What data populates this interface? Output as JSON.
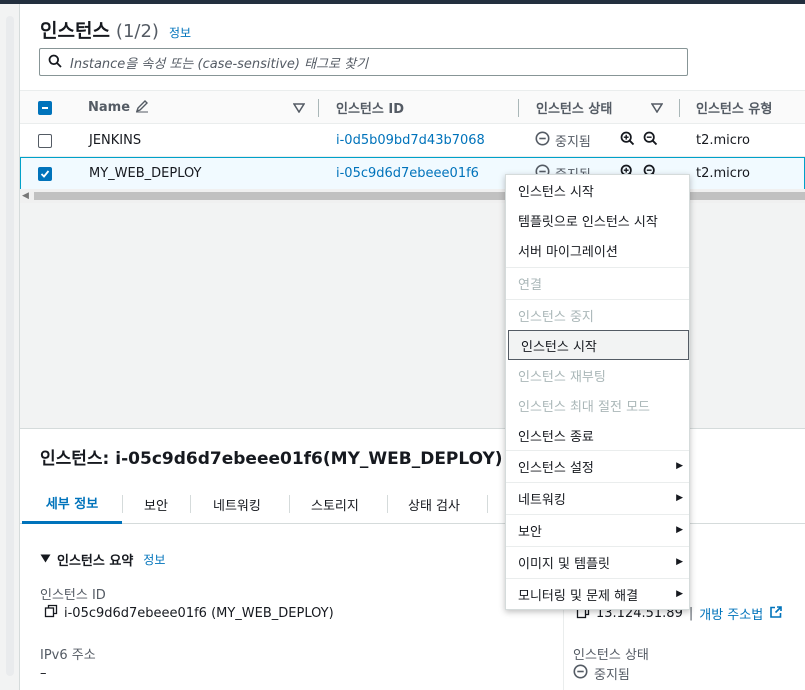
{
  "header": {
    "title": "인스턴스",
    "count": "(1/2)",
    "info": "정보"
  },
  "search": {
    "placeholder": "Instance을 속성 또는 (case-sensitive) 태그로 찾기"
  },
  "columns": {
    "name": "Name",
    "instance_id": "인스턴스 ID",
    "state": "인스턴스 상태",
    "type": "인스턴스 유형"
  },
  "rows": [
    {
      "name": "JENKINS",
      "id": "i-0d5b09bd7d43b7068",
      "state": "중지됨",
      "type": "t2.micro",
      "selected": false
    },
    {
      "name": "MY_WEB_DEPLOY",
      "id": "i-05c9d6d7ebeee01f6",
      "state": "중지됨",
      "type": "t2.micro",
      "selected": true
    }
  ],
  "context_menu": {
    "start_instance": "인스턴스 시작",
    "launch_from_template": "템플릿으로 인스턴스 시작",
    "server_migration": "서버 마이그레이션",
    "connect": "연결",
    "stop_instance": "인스턴스 중지",
    "start_instance_2": "인스턴스 시작",
    "reboot_instance": "인스턴스 재부팅",
    "hibernate_instance": "인스턴스 최대 절전 모드",
    "terminate_instance": "인스턴스 종료",
    "instance_settings": "인스턴스 설정",
    "networking": "네트워킹",
    "security": "보안",
    "image_templates": "이미지 및 템플릿",
    "monitor_troubleshoot": "모니터링 및 문제 해결"
  },
  "details": {
    "title": "인스턴스: i-05c9d6d7ebeee01f6(MY_WEB_DEPLOY)",
    "tabs": [
      "세부 정보",
      "보안",
      "네트워킹",
      "스토리지",
      "상태 검사"
    ],
    "summary": "인스턴스 요약",
    "info": "정보",
    "instance_id_label": "인스턴스 ID",
    "instance_id_value": "i-05c9d6d7ebeee01f6 (MY_WEB_DEPLOY)",
    "ipv6_label": "IPv6 주소",
    "ipv6_value": "–",
    "public_ip": "13.124.51.89",
    "open_address": "개방 주소법",
    "state_label": "인스턴스 상태",
    "state_value": "중지됨"
  },
  "colors": {
    "link": "#0073bb",
    "selected_bg": "#f1faff",
    "accent": "#0073bb"
  },
  "icons": [
    "search-icon",
    "pencil-icon",
    "sort-down-icon",
    "stopped-icon",
    "zoom-in-icon",
    "zoom-out-icon",
    "copy-icon",
    "external-link-icon",
    "caret-right-icon",
    "triangle-down-icon"
  ]
}
